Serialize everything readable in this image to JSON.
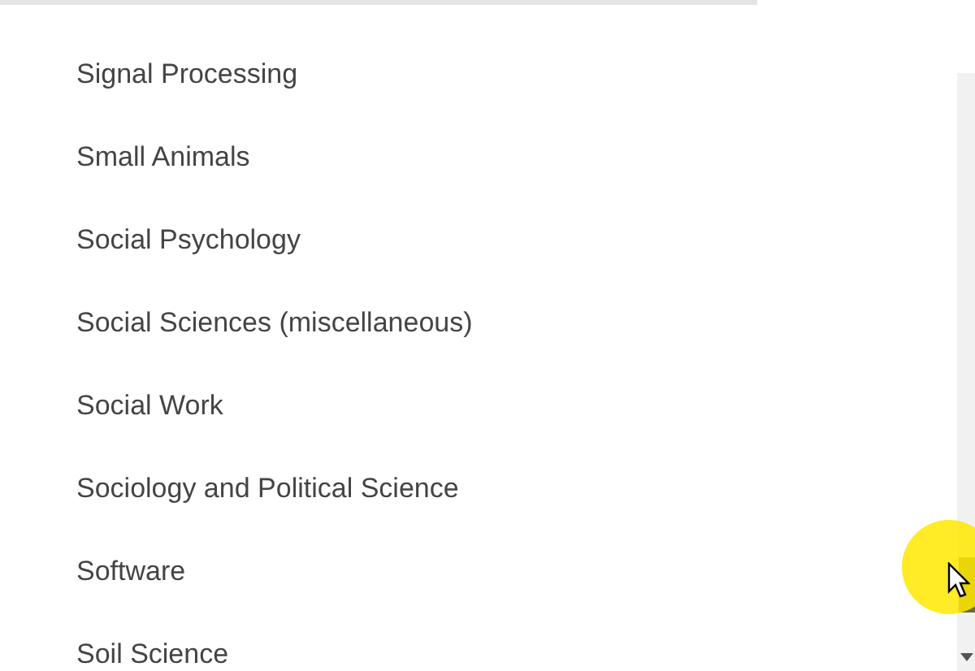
{
  "list": {
    "items": [
      {
        "label": "Signal Processing"
      },
      {
        "label": "Small Animals"
      },
      {
        "label": "Social Psychology"
      },
      {
        "label": "Social Sciences (miscellaneous)"
      },
      {
        "label": "Social Work"
      },
      {
        "label": "Sociology and Political Science"
      },
      {
        "label": "Software"
      },
      {
        "label": "Soil Science"
      }
    ]
  }
}
